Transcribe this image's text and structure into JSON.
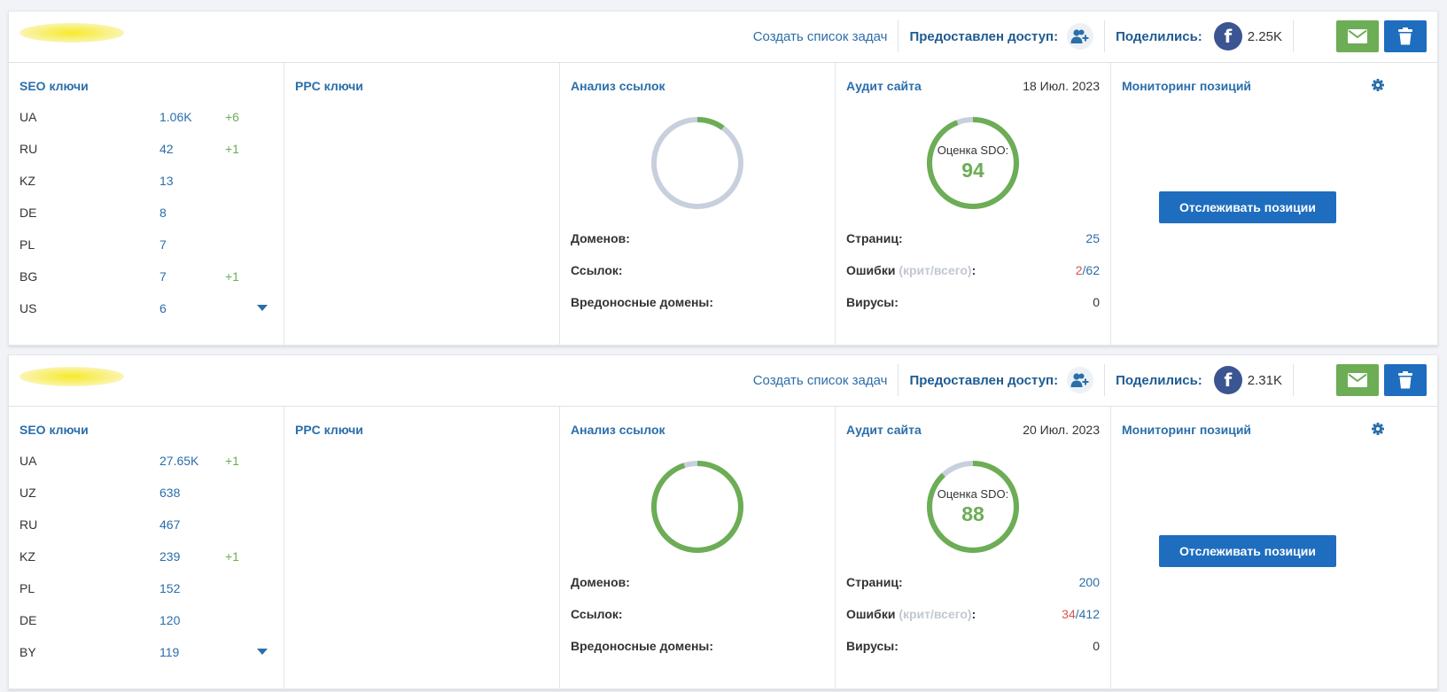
{
  "colors": {
    "accent": "#2a6eaa",
    "green": "#6cad55",
    "blue_button": "#1e6dbf",
    "ring_track": "#c8d0de",
    "facebook": "#3b5593",
    "critical": "#d9534f"
  },
  "projects": [
    {
      "header": {
        "create_task": "Создать список задач",
        "access_label": "Предоставлен доступ:",
        "shared_label": "Поделились:",
        "shared_count": "2.25K"
      },
      "seo": {
        "title": "SEO ключи",
        "rows": [
          {
            "country": "UA",
            "count": "1.06K",
            "delta": "+6"
          },
          {
            "country": "RU",
            "count": "42",
            "delta": "+1"
          },
          {
            "country": "KZ",
            "count": "13",
            "delta": ""
          },
          {
            "country": "DE",
            "count": "8",
            "delta": ""
          },
          {
            "country": "PL",
            "count": "7",
            "delta": ""
          },
          {
            "country": "BG",
            "count": "7",
            "delta": "+1"
          },
          {
            "country": "US",
            "count": "6",
            "delta": ""
          }
        ]
      },
      "ppc": {
        "title": "PPC ключи"
      },
      "links": {
        "title": "Анализ ссылок",
        "ring_fraction": 0.1,
        "ring_color": "green",
        "domains_label": "Доменов:",
        "links_label": "Ссылок:",
        "malicious_label": "Вредоносные домены:"
      },
      "audit": {
        "title": "Аудит сайта",
        "date": "18 Июл. 2023",
        "score_label": "Оценка SDO:",
        "score": "94",
        "score_fraction": 0.94,
        "pages_label": "Страниц:",
        "pages": "25",
        "errors_label": "Ошибки",
        "errors_hint": "(крит/всего)",
        "errors_colon": ":",
        "errors_crit": "2",
        "errors_sep": "/",
        "errors_total": "62",
        "viruses_label": "Вирусы:",
        "viruses": "0"
      },
      "monitoring": {
        "title": "Мониторинг позиций",
        "button": "Отслеживать позиции"
      }
    },
    {
      "header": {
        "create_task": "Создать список задач",
        "access_label": "Предоставлен доступ:",
        "shared_label": "Поделились:",
        "shared_count": "2.31K"
      },
      "seo": {
        "title": "SEO ключи",
        "rows": [
          {
            "country": "UA",
            "count": "27.65K",
            "delta": "+1"
          },
          {
            "country": "UZ",
            "count": "638",
            "delta": ""
          },
          {
            "country": "RU",
            "count": "467",
            "delta": ""
          },
          {
            "country": "KZ",
            "count": "239",
            "delta": "+1"
          },
          {
            "country": "PL",
            "count": "152",
            "delta": ""
          },
          {
            "country": "DE",
            "count": "120",
            "delta": ""
          },
          {
            "country": "BY",
            "count": "119",
            "delta": ""
          }
        ]
      },
      "ppc": {
        "title": "PPC ключи"
      },
      "links": {
        "title": "Анализ ссылок",
        "ring_fraction": 0.95,
        "ring_color": "green",
        "domains_label": "Доменов:",
        "links_label": "Ссылок:",
        "malicious_label": "Вредоносные домены:"
      },
      "audit": {
        "title": "Аудит сайта",
        "date": "20 Июл. 2023",
        "score_label": "Оценка SDO:",
        "score": "88",
        "score_fraction": 0.88,
        "pages_label": "Страниц:",
        "pages": "200",
        "errors_label": "Ошибки",
        "errors_hint": "(крит/всего)",
        "errors_colon": ":",
        "errors_crit": "34",
        "errors_sep": "/",
        "errors_total": "412",
        "viruses_label": "Вирусы:",
        "viruses": "0"
      },
      "monitoring": {
        "title": "Мониторинг позиций",
        "button": "Отслеживать позиции"
      }
    }
  ]
}
